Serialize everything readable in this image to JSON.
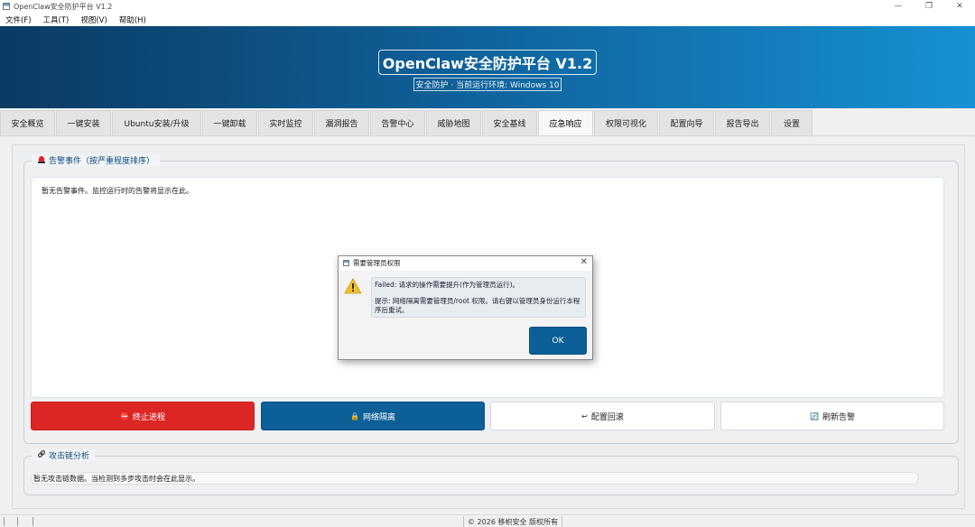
{
  "window": {
    "title": "OpenClaw安全防护平台 V1.2",
    "controls": {
      "minimize": "—",
      "maximize": "❐",
      "close": "✕"
    }
  },
  "menu": [
    "文件(F)",
    "工具(T)",
    "视图(V)",
    "帮助(H)"
  ],
  "banner": {
    "title": "OpenClaw安全防护平台 V1.2",
    "subtitle": "安全防护 · 当前运行环境: Windows 10"
  },
  "tabs": [
    "安全概览",
    "一键安装",
    "Ubuntu安装/升级",
    "一键卸载",
    "实时监控",
    "漏洞报告",
    "告警中心",
    "威胁地图",
    "安全基线",
    "应急响应",
    "权限可视化",
    "配置向导",
    "报告导出",
    "设置"
  ],
  "active_tab": "应急响应",
  "alerts": {
    "legend": "告警事件（按严重程度排序）",
    "legend_icon": "siren-icon",
    "empty_message": "暂无告警事件。监控运行时的告警将显示在此。"
  },
  "actions": {
    "kill": {
      "label": "终止进程",
      "icon": "⛔",
      "color": "#dc2626"
    },
    "isolate": {
      "label": "网络隔离",
      "icon": "🔒",
      "color": "#0d5f98"
    },
    "rollback": {
      "label": "配置回滚",
      "icon": "↩"
    },
    "refresh": {
      "label": "刷新告警",
      "icon": "🔄"
    }
  },
  "attack_chain": {
    "legend": "攻击链分析",
    "legend_icon": "link-icon",
    "empty_message": "暂无攻击链数据。当检测到多步攻击时会在此显示。"
  },
  "status_bar": {
    "copyright": "© 2026 移帜安全 版权所有"
  },
  "dialog": {
    "title": "需要管理员权限",
    "message": "Failed: 请求的操作需要提升(作为管理员运行)。",
    "hint": "提示: 网络隔离需要管理员/root 权限。请右键以管理员身份运行本程序后重试。",
    "ok_label": "OK",
    "icon": "warning-icon"
  }
}
